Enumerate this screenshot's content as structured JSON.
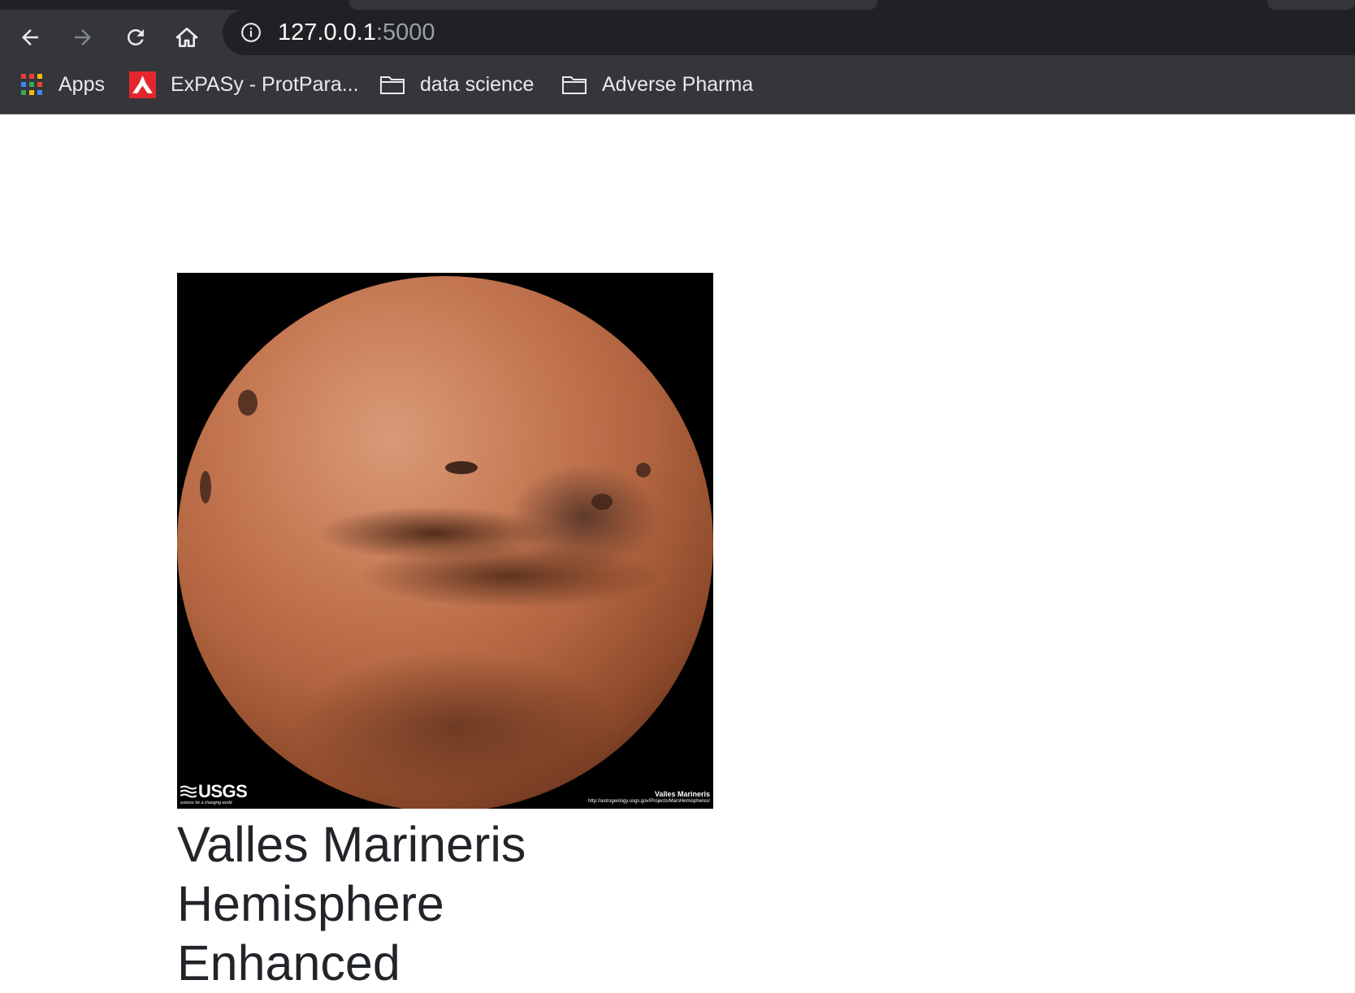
{
  "browser": {
    "nav_icons": [
      "back-arrow-icon",
      "forward-arrow-icon",
      "reload-icon",
      "home-icon"
    ],
    "address_bar": {
      "icon": "info-icon",
      "host": "127.0.0.1",
      "port": ":5000"
    },
    "bookmarks": [
      {
        "icon": "apps-grid-icon",
        "label": "Apps"
      },
      {
        "icon": "expasy-logo-icon",
        "label": "ExPASy - ProtPara..."
      },
      {
        "icon": "folder-icon",
        "label": "data science"
      },
      {
        "icon": "folder-icon",
        "label": "Adverse Pharma"
      }
    ],
    "colors": {
      "toolbar": "#35363a",
      "omnibox": "#202124",
      "text": "#e8eaed"
    }
  },
  "page": {
    "hemisphere": {
      "image_label": {
        "logo": "USGS",
        "logo_tagline": "science for a changing world",
        "credit_title": "Valles Marineris",
        "credit_url": "http://astrogeology.usgs.gov/Projects/MarsHemispheres/"
      },
      "title": "Valles Marineris Hemisphere Enhanced"
    },
    "colors": {
      "caption": "#212529",
      "background": "#ffffff"
    }
  }
}
